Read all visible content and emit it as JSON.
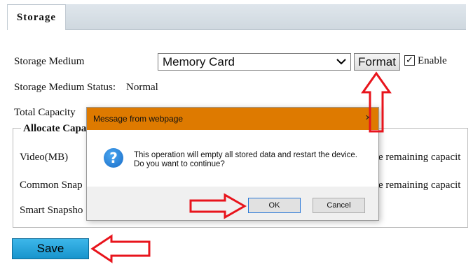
{
  "tab": {
    "label": "Storage"
  },
  "form": {
    "storage_medium_label": "Storage Medium",
    "storage_medium_value": "Memory Card",
    "format_label": "Format",
    "enable_label": "Enable",
    "enable_checked": true,
    "status_label": "Storage Medium Status:",
    "status_value": "Normal",
    "total_capacity_label": "Total Capacity",
    "allocate_legend": "Allocate Capa",
    "rows": [
      {
        "label": "Video(MB)",
        "tail": "e remaining capacit"
      },
      {
        "label": "Common Snap",
        "tail": "e remaining capacit"
      },
      {
        "label": "Smart Snapsho",
        "tail": ""
      }
    ],
    "save_label": "Save"
  },
  "dialog": {
    "title": "Message from webpage",
    "close": "×",
    "message": "This operation will empty all stored data and restart the device. Do you want to continue?",
    "ok_label": "OK",
    "cancel_label": "Cancel",
    "icon": "question-icon"
  },
  "annotations": {
    "arrow_color": "#e8141c"
  }
}
